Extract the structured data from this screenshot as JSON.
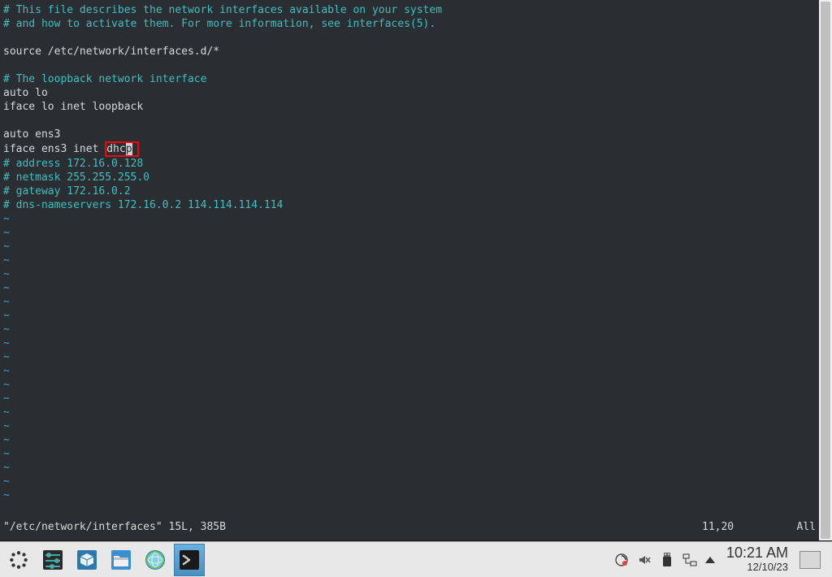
{
  "editor": {
    "lines": [
      {
        "text": "# This file describes the network interfaces available on your system",
        "class": "comment"
      },
      {
        "text": "# and how to activate them. For more information, see interfaces(5).",
        "class": "comment"
      },
      {
        "text": "",
        "class": ""
      },
      {
        "text": "source /etc/network/interfaces.d/*",
        "class": ""
      },
      {
        "text": "",
        "class": ""
      },
      {
        "text": "# The loopback network interface",
        "class": "comment"
      },
      {
        "text": "auto lo",
        "class": ""
      },
      {
        "text": "iface lo inet loopback",
        "class": ""
      },
      {
        "text": "",
        "class": ""
      },
      {
        "text": "auto ens3",
        "class": ""
      },
      {
        "special": "dhcp_line",
        "prefix": "iface ens3 inet ",
        "highlighted_pre": "dhc",
        "highlighted_cursor": "p"
      },
      {
        "text": "# address 172.16.0.128",
        "class": "comment"
      },
      {
        "text": "# netmask 255.255.255.0",
        "class": "comment"
      },
      {
        "text": "# gateway 172.16.0.2",
        "class": "comment"
      },
      {
        "text": "# dns-nameservers 172.16.0.2 114.114.114.114",
        "class": "comment"
      }
    ],
    "tilde": "~",
    "tilde_count": 21,
    "status": {
      "file": "\"/etc/network/interfaces\" 15L, 385B",
      "position": "11,20",
      "scroll": "All"
    }
  },
  "taskbar": {
    "clock": {
      "time": "10:21 AM",
      "date": "12/10/23"
    }
  }
}
